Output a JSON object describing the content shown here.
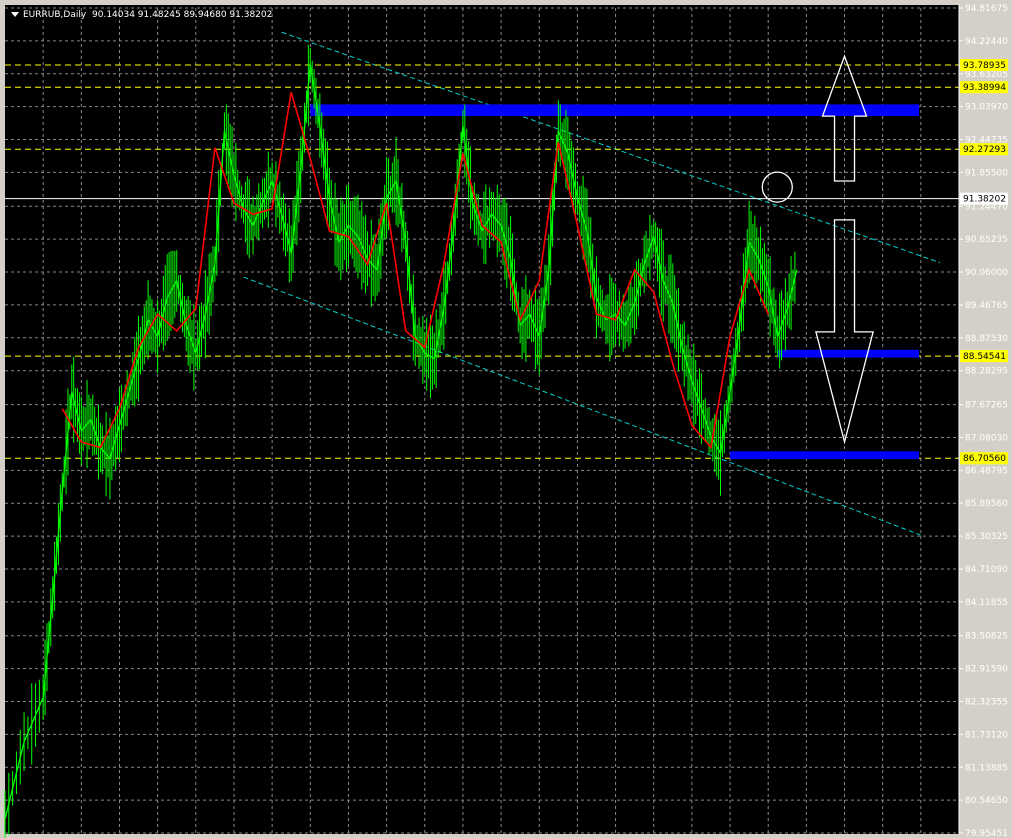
{
  "header": {
    "symbol": "EURRUB,Daily",
    "ohlc": "90.14034 91.48245 89.94680 91.38202"
  },
  "colors": {
    "background": "#000000",
    "grid": "#8a8a8a",
    "price_series": "#00ff00",
    "moving_average": "#ff0000",
    "horizontal_levels": "#ffff00",
    "level_label_bg": "#ffff00",
    "zones": "#0000ff",
    "trend_channel": "#00cccc",
    "current_price_line": "#ffffff",
    "arrows": "#ffffff",
    "axis_text": "#ffffff"
  },
  "chart_data": {
    "type": "line",
    "title": "EURRUB,Daily",
    "xlabel": "",
    "ylabel": "",
    "ylim": [
      79.95451,
      94.81675
    ],
    "grid": true,
    "y_ticks": [
      "94.81675",
      "94.22440",
      "93.63205",
      "93.03970",
      "92.44735",
      "91.85500",
      "91.24470",
      "90.65235",
      "90.06000",
      "89.46765",
      "88.87530",
      "88.28295",
      "87.67265",
      "87.08030",
      "86.48795",
      "85.89560",
      "85.30325",
      "84.71090",
      "84.11855",
      "83.50825",
      "82.91590",
      "82.32355",
      "81.73120",
      "81.13885",
      "80.54650",
      "79.95451"
    ],
    "y_tick_values": [
      94.81675,
      94.2244,
      93.63205,
      93.0397,
      92.44735,
      91.855,
      91.2447,
      90.65235,
      90.06,
      89.46765,
      88.8753,
      88.28295,
      87.67265,
      87.0803,
      86.48795,
      85.8956,
      85.30325,
      84.7109,
      84.11855,
      83.50825,
      82.9159,
      82.32355,
      81.7312,
      81.13885,
      80.5465,
      79.95451
    ],
    "x_index_range": [
      0,
      100
    ],
    "series": [
      {
        "name": "EURRUB close",
        "x": [
          0,
          2,
          4,
          5,
          6,
          7,
          8,
          9,
          10,
          11,
          12,
          13,
          14,
          15,
          16,
          17,
          18,
          19,
          20,
          21,
          22,
          23,
          24,
          25,
          26,
          27,
          28,
          29,
          30,
          31,
          32,
          33,
          34,
          35,
          36,
          37,
          38,
          39,
          40,
          41,
          42,
          43,
          44,
          45,
          46,
          47,
          48,
          49,
          50,
          51,
          52,
          53,
          54,
          55,
          56,
          57,
          58,
          59,
          60,
          61,
          62,
          63,
          64,
          65,
          66,
          67,
          68,
          69,
          70,
          71,
          72,
          73,
          74,
          75,
          76,
          77,
          78,
          79,
          80,
          81,
          82,
          83,
          84,
          85,
          86,
          87,
          88,
          89,
          90,
          91,
          92,
          93,
          94,
          95,
          96,
          97,
          98,
          99,
          100
        ],
        "values": [
          80.2,
          81.6,
          82.4,
          84.2,
          86.1,
          87.9,
          87.2,
          87.4,
          86.9,
          86.7,
          87.3,
          87.9,
          88.5,
          89.2,
          88.9,
          89.6,
          89.9,
          89.1,
          88.6,
          89.3,
          90.2,
          92.6,
          91.8,
          91.2,
          90.9,
          91.3,
          91.7,
          91.1,
          90.4,
          91.9,
          93.8,
          92.7,
          91.4,
          90.6,
          90.9,
          90.7,
          90.3,
          90.1,
          91.4,
          91.7,
          90.6,
          88.9,
          88.6,
          88.5,
          89.4,
          90.8,
          92.7,
          91.3,
          90.8,
          91.1,
          90.9,
          90.3,
          89.1,
          89.3,
          88.9,
          90.1,
          92.6,
          92.2,
          91.4,
          90.8,
          89.6,
          89.2,
          89.3,
          89.1,
          89.5,
          90.2,
          90.7,
          89.9,
          89.5,
          88.7,
          88.1,
          87.6,
          87.1,
          86.8,
          87.9,
          89.1,
          90.6,
          90.3,
          89.8,
          88.9,
          89.4,
          90.1,
          91.4,
          91.38,
          91.38,
          91.38,
          91.38,
          91.38,
          91.38,
          91.38,
          91.38,
          91.38,
          91.38,
          91.38,
          91.38,
          91.38,
          91.38,
          91.38,
          91.38
        ]
      }
    ],
    "moving_average": {
      "name": "moving average",
      "x": [
        6,
        8,
        10,
        12,
        14,
        16,
        18,
        20,
        22,
        24,
        26,
        28,
        30,
        32,
        34,
        36,
        38,
        40,
        42,
        44,
        46,
        48,
        50,
        52,
        54,
        56,
        58,
        60,
        62,
        64,
        66,
        68,
        70,
        72,
        74,
        76,
        78,
        80
      ],
      "values": [
        87.6,
        87.0,
        86.9,
        87.6,
        88.7,
        89.3,
        89.0,
        89.4,
        92.3,
        91.3,
        91.1,
        91.2,
        93.3,
        92.1,
        90.8,
        90.7,
        90.2,
        91.3,
        89.0,
        88.7,
        90.2,
        92.2,
        90.9,
        90.6,
        89.2,
        89.9,
        92.4,
        90.9,
        89.3,
        89.2,
        90.1,
        89.7,
        88.4,
        87.3,
        86.9,
        88.9,
        90.1,
        89.3
      ]
    },
    "horizontal_levels": [
      {
        "label": "93.78935",
        "value": 93.78935
      },
      {
        "label": "93.38994",
        "value": 93.38994
      },
      {
        "label": "92.27293",
        "value": 92.27293
      },
      {
        "label": "88.54541",
        "value": 88.54541
      },
      {
        "label": "86.70560",
        "value": 86.7056
      }
    ],
    "current_price": {
      "label": "91.38202",
      "value": 91.38202
    },
    "zones": [
      {
        "x_start": 32,
        "x_end": 100,
        "y_top": 93.08,
        "y_bottom": 92.87
      },
      {
        "x_start": 81,
        "x_end": 100,
        "y_top": 88.66,
        "y_bottom": 88.52
      },
      {
        "x_start": 76,
        "x_end": 99,
        "y_top": 86.83,
        "y_bottom": 86.69
      }
    ],
    "trend_channel": [
      {
        "x1": 29,
        "y1": 94.38,
        "x2": 98,
        "y2": 90.23
      },
      {
        "x1": 25,
        "y1": 89.97,
        "x2": 96,
        "y2": 85.32
      }
    ],
    "arrows": [
      {
        "direction": "up",
        "x": 88,
        "y_from": 91.7,
        "y_to": 93.95
      },
      {
        "direction": "down",
        "x": 88,
        "y_from": 91.0,
        "y_to": 87.0
      }
    ],
    "marker_circle": {
      "x": 82,
      "y": 91.5
    }
  }
}
